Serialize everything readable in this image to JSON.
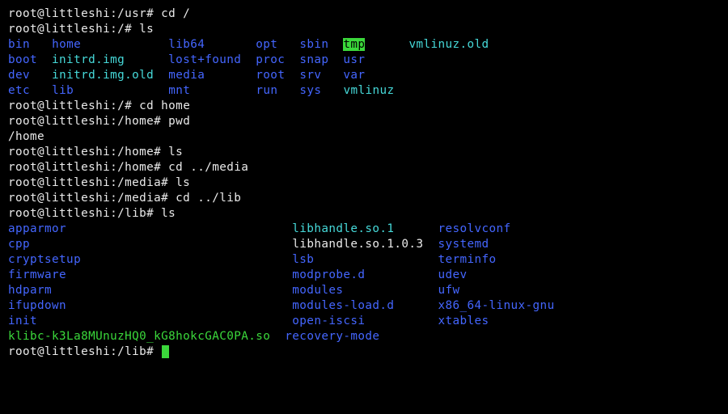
{
  "lines": {
    "l01": {
      "prompt": "root@littleshi:/usr#",
      "cmd": " cd /"
    },
    "l02": {
      "prompt": "root@littleshi:/#",
      "cmd": " ls"
    },
    "l03": {
      "c1": "bin",
      "c2": "home",
      "c3": "lib64",
      "c4": "opt",
      "c5": "sbin",
      "c6": "tmp",
      "c7": "vmlinuz.old"
    },
    "l04": {
      "c1": "boot",
      "c2": "initrd.img",
      "c3": "lost+found",
      "c4": "proc",
      "c5": "snap",
      "c6": "usr"
    },
    "l05": {
      "c1": "dev",
      "c2": "initrd.img.old",
      "c3": "media",
      "c4": "root",
      "c5": "srv",
      "c6": "var"
    },
    "l06": {
      "c1": "etc",
      "c2": "lib",
      "c3": "mnt",
      "c4": "run",
      "c5": "sys",
      "c6": "vmlinuz"
    },
    "l07": {
      "prompt": "root@littleshi:/#",
      "cmd": " cd home"
    },
    "l08": {
      "prompt": "root@littleshi:/home#",
      "cmd": " pwd"
    },
    "l09": "/home",
    "l10": {
      "prompt": "root@littleshi:/home#",
      "cmd": " ls"
    },
    "l11": {
      "prompt": "root@littleshi:/home#",
      "cmd": " cd ../media"
    },
    "l12": {
      "prompt": "root@littleshi:/media#",
      "cmd": " ls"
    },
    "l13": {
      "prompt": "root@littleshi:/media#",
      "cmd": " cd ../lib"
    },
    "l14": {
      "prompt": "root@littleshi:/lib#",
      "cmd": " ls"
    },
    "l15": {
      "c1": "apparmor",
      "c2": "libhandle.so.1",
      "c3": "resolvconf"
    },
    "l16": {
      "c1": "cpp",
      "c2": "libhandle.so.1.0.3",
      "c3": "systemd"
    },
    "l17": {
      "c1": "cryptsetup",
      "c2": "lsb",
      "c3": "terminfo"
    },
    "l18": {
      "c1": "firmware",
      "c2": "modprobe.d",
      "c3": "udev"
    },
    "l19": {
      "c1": "hdparm",
      "c2": "modules",
      "c3": "ufw"
    },
    "l20": {
      "c1": "ifupdown",
      "c2": "modules-load.d",
      "c3": "x86_64-linux-gnu"
    },
    "l21": {
      "c1": "init",
      "c2": "open-iscsi",
      "c3": "xtables"
    },
    "l22": {
      "c1": "klibc-k3La8MUnuzHQ0_kG8hokcGAC0PA.so",
      "c2": "recovery-mode"
    },
    "l23": {
      "prompt": "root@littleshi:/lib#"
    }
  }
}
